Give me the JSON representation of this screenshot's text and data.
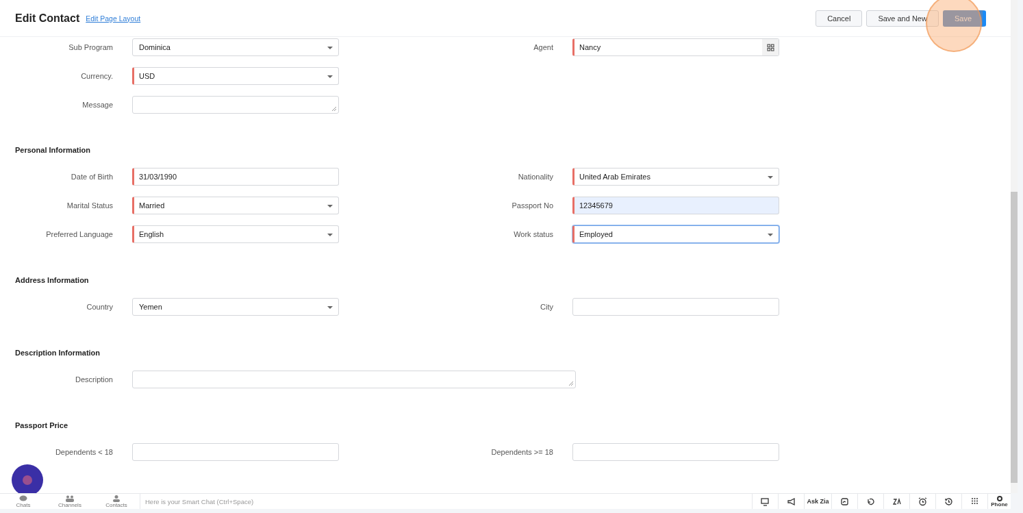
{
  "header": {
    "title": "Edit Contact",
    "layout_link": "Edit Page Layout",
    "buttons": [
      {
        "label": "Cancel",
        "kind": "plain"
      },
      {
        "label": "Save and New",
        "kind": "plain"
      },
      {
        "label": "Save",
        "kind": "primary"
      }
    ]
  },
  "sections": [
    {
      "rows": [
        [
          {
            "label": "Sub Program",
            "kind": "select",
            "value": "Dominica",
            "required": false,
            "autofilled": false,
            "focused": false
          },
          {
            "label": "Agent",
            "kind": "lookup",
            "value": "Nancy",
            "required": true,
            "autofilled": false,
            "focused": false
          }
        ],
        [
          {
            "label": "Currency.",
            "kind": "select",
            "value": "USD",
            "required": true,
            "autofilled": false,
            "focused": false
          },
          null
        ],
        [
          {
            "label": "Message",
            "kind": "textarea",
            "required": false,
            "autofilled": false,
            "focused": false
          },
          null
        ]
      ]
    },
    {
      "title": "Personal Information",
      "rows": [
        [
          {
            "label": "Date of Birth",
            "kind": "text",
            "value": "31/03/1990",
            "required": true,
            "autofilled": false,
            "focused": false
          },
          {
            "label": "Nationality",
            "kind": "select",
            "value": "United Arab Emirates",
            "required": true,
            "autofilled": false,
            "focused": false
          }
        ],
        [
          {
            "label": "Marital Status",
            "kind": "select",
            "value": "Married",
            "required": true,
            "autofilled": false,
            "focused": false
          },
          {
            "label": "Passport No",
            "kind": "text",
            "value": "12345679",
            "required": true,
            "autofilled": true,
            "focused": false
          }
        ],
        [
          {
            "label": "Preferred Language",
            "kind": "select",
            "value": "English",
            "required": true,
            "autofilled": false,
            "focused": false
          },
          {
            "label": "Work status",
            "kind": "select",
            "value": "Employed",
            "required": true,
            "autofilled": false,
            "focused": true
          }
        ]
      ]
    },
    {
      "title": "Address Information",
      "rows": [
        [
          {
            "label": "Country",
            "kind": "select",
            "value": "Yemen",
            "required": false,
            "autofilled": false,
            "focused": false
          },
          {
            "label": "City",
            "kind": "text",
            "required": false,
            "autofilled": false,
            "focused": false
          }
        ]
      ]
    },
    {
      "title": "Description Information",
      "rows": [
        [
          {
            "label": "Description",
            "kind": "long_textarea",
            "required": false,
            "autofilled": false,
            "focused": false
          }
        ]
      ]
    },
    {
      "title": "Passport Price",
      "rows": [
        [
          {
            "label": "Dependents < 18",
            "kind": "text",
            "required": false,
            "autofilled": false,
            "focused": false
          },
          {
            "label": "Dependents >= 18",
            "kind": "text",
            "required": false,
            "autofilled": false,
            "focused": false
          }
        ]
      ]
    }
  ],
  "bottom_bar": {
    "tabs": [
      "Chats",
      "Channels",
      "Contacts"
    ],
    "chat_placeholder": "Here is your Smart Chat (Ctrl+Space)",
    "tools": [
      {
        "kind": "icon"
      },
      {
        "kind": "icon"
      },
      {
        "kind": "text",
        "label": "Ask Zia"
      },
      {
        "kind": "icon"
      },
      {
        "kind": "icon"
      },
      {
        "kind": "icon"
      },
      {
        "kind": "icon"
      },
      {
        "kind": "icon"
      },
      {
        "kind": "icon"
      },
      {
        "kind": "phone",
        "label": "Phone"
      }
    ]
  }
}
